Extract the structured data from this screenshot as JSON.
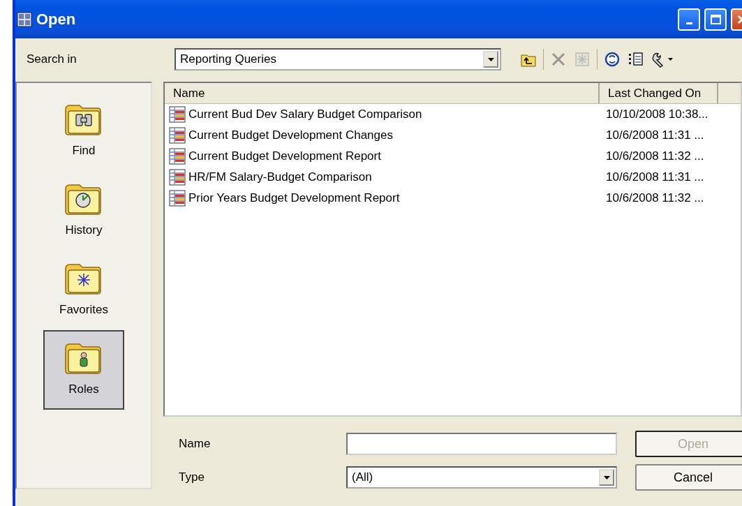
{
  "window": {
    "title": "Open"
  },
  "search_in": {
    "label": "Search in",
    "value": "Reporting Queries"
  },
  "toolbar": [
    {
      "kind": "up-folder",
      "disabled": false
    },
    {
      "kind": "delete",
      "disabled": true
    },
    {
      "kind": "properties",
      "disabled": true
    },
    {
      "kind": "refresh",
      "disabled": false
    },
    {
      "kind": "details",
      "disabled": false
    },
    {
      "kind": "tools",
      "disabled": false
    }
  ],
  "places": [
    {
      "label": "Find",
      "kind": "find",
      "selected": false
    },
    {
      "label": "History",
      "kind": "history",
      "selected": false
    },
    {
      "label": "Favorites",
      "kind": "favorites",
      "selected": false
    },
    {
      "label": "Roles",
      "kind": "roles",
      "selected": true
    }
  ],
  "list": {
    "columns": [
      "Name",
      "Last Changed On"
    ],
    "rows": [
      {
        "name": "Current Bud Dev Salary Budget Comparison",
        "changed": "10/10/2008 10:38..."
      },
      {
        "name": "Current Budget Development Changes",
        "changed": "10/6/2008 11:31 ..."
      },
      {
        "name": "Current Budget Development Report",
        "changed": "10/6/2008 11:32 ..."
      },
      {
        "name": "HR/FM Salary-Budget Comparison",
        "changed": "10/6/2008 11:31 ..."
      },
      {
        "name": "Prior Years Budget Development Report",
        "changed": "10/6/2008 11:32 ..."
      }
    ]
  },
  "name_field": {
    "label": "Name"
  },
  "type_field": {
    "label": "Type",
    "value": "(All)"
  },
  "buttons": [
    {
      "label": "Open",
      "disabled": true
    },
    {
      "label": "Cancel",
      "disabled": false
    }
  ]
}
